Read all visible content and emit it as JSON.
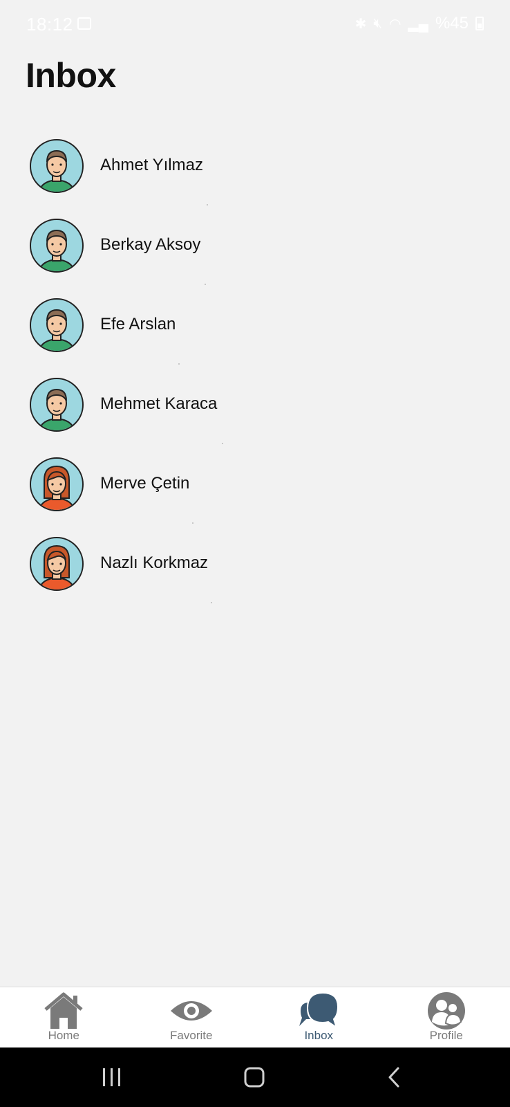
{
  "status_bar": {
    "time": "18:12",
    "battery_text": "%45",
    "icons": [
      "gallery-icon",
      "bluetooth-icon",
      "mute-icon",
      "wifi-icon",
      "volte-icon",
      "signal-icon",
      "battery-icon"
    ]
  },
  "header": {
    "title": "Inbox"
  },
  "contacts": [
    {
      "name": "Ahmet Yılmaz",
      "avatar": "male-avatar"
    },
    {
      "name": "Berkay Aksoy",
      "avatar": "male-avatar"
    },
    {
      "name": "Efe Arslan",
      "avatar": "male-avatar"
    },
    {
      "name": "Mehmet Karaca",
      "avatar": "male-avatar"
    },
    {
      "name": "Merve Çetin",
      "avatar": "female-avatar"
    },
    {
      "name": "Nazlı Korkmaz",
      "avatar": "female-avatar"
    }
  ],
  "bottom_nav": {
    "items": [
      {
        "label": "Home",
        "icon": "home-icon",
        "active": false
      },
      {
        "label": "Favorite",
        "icon": "eye-icon",
        "active": false
      },
      {
        "label": "Inbox",
        "icon": "chat-bubbles-icon",
        "active": true
      },
      {
        "label": "Profile",
        "icon": "people-icon",
        "active": false
      }
    ]
  },
  "colors": {
    "background": "#f2f2f2",
    "nav_inactive": "#7a7a7a",
    "nav_active": "#3d5a73",
    "avatar_bg": "#9dd7e0",
    "male_shirt": "#3aa56b",
    "female_shirt": "#ea5a2c",
    "female_hair": "#c8582a"
  }
}
